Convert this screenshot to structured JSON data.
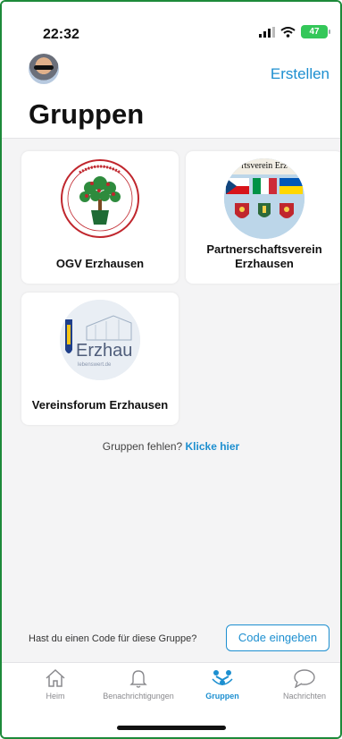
{
  "status": {
    "time": "22:32",
    "battery": "47"
  },
  "header": {
    "create_label": "Erstellen",
    "title": "Gruppen"
  },
  "groups": [
    {
      "name": "OGV Erzhausen"
    },
    {
      "name": "Partnerschaftsverein Erzhausen",
      "logo_text": "rtsverein Erz"
    },
    {
      "name": "Vereinsforum Erzhausen",
      "logo_text": "Erzhau",
      "logo_subtext": "lebenswert.de"
    }
  ],
  "missing": {
    "text": "Gruppen fehlen?",
    "link": "Klicke hier"
  },
  "code": {
    "prompt": "Hast du einen Code für diese Gruppe?",
    "button": "Code eingeben"
  },
  "tabs": [
    {
      "label": "Heim",
      "icon": "home-icon"
    },
    {
      "label": "Benachrichtigungen",
      "icon": "bell-icon"
    },
    {
      "label": "Gruppen",
      "icon": "groups-icon",
      "active": true
    },
    {
      "label": "Nachrichten",
      "icon": "chat-bubble-icon"
    }
  ],
  "colors": {
    "accent": "#1d8fd0",
    "battery": "#34c759"
  }
}
